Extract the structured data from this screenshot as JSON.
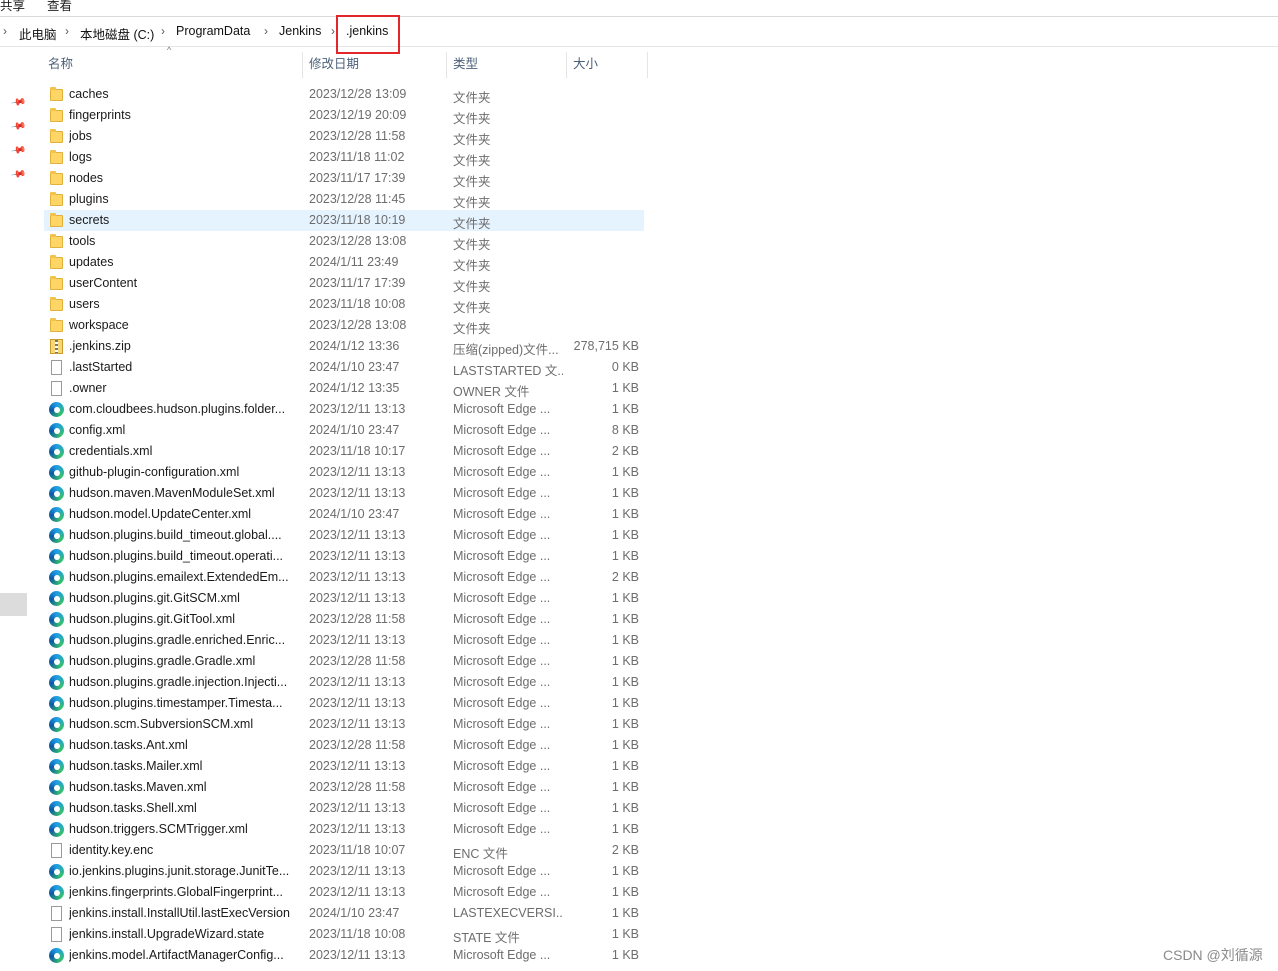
{
  "ribbon": {
    "tabs": [
      "共享",
      "查看"
    ]
  },
  "breadcrumb": [
    "此电脑",
    "本地磁盘 (C:)",
    "ProgramData",
    "Jenkins",
    ".jenkins"
  ],
  "columns": {
    "name": "名称",
    "date": "修改日期",
    "type": "类型",
    "size": "大小"
  },
  "files": [
    {
      "name": "caches",
      "date": "2023/12/28 13:09",
      "type": "文件夹",
      "size": "",
      "icon": "folder-icon"
    },
    {
      "name": "fingerprints",
      "date": "2023/12/19 20:09",
      "type": "文件夹",
      "size": "",
      "icon": "folder-icon"
    },
    {
      "name": "jobs",
      "date": "2023/12/28 11:58",
      "type": "文件夹",
      "size": "",
      "icon": "folder-icon"
    },
    {
      "name": "logs",
      "date": "2023/11/18 11:02",
      "type": "文件夹",
      "size": "",
      "icon": "folder-icon"
    },
    {
      "name": "nodes",
      "date": "2023/11/17 17:39",
      "type": "文件夹",
      "size": "",
      "icon": "folder-icon"
    },
    {
      "name": "plugins",
      "date": "2023/12/28 11:45",
      "type": "文件夹",
      "size": "",
      "icon": "folder-icon"
    },
    {
      "name": "secrets",
      "date": "2023/11/18 10:19",
      "type": "文件夹",
      "size": "",
      "icon": "folder-icon",
      "selected": true
    },
    {
      "name": "tools",
      "date": "2023/12/28 13:08",
      "type": "文件夹",
      "size": "",
      "icon": "folder-icon"
    },
    {
      "name": "updates",
      "date": "2024/1/11 23:49",
      "type": "文件夹",
      "size": "",
      "icon": "folder-icon"
    },
    {
      "name": "userContent",
      "date": "2023/11/17 17:39",
      "type": "文件夹",
      "size": "",
      "icon": "folder-icon"
    },
    {
      "name": "users",
      "date": "2023/11/18 10:08",
      "type": "文件夹",
      "size": "",
      "icon": "folder-icon"
    },
    {
      "name": "workspace",
      "date": "2023/12/28 13:08",
      "type": "文件夹",
      "size": "",
      "icon": "folder-icon"
    },
    {
      "name": ".jenkins.zip",
      "date": "2024/1/12 13:36",
      "type": "压缩(zipped)文件...",
      "size": "278,715 KB",
      "icon": "zip-icon"
    },
    {
      "name": ".lastStarted",
      "date": "2024/1/10 23:47",
      "type": "LASTSTARTED 文...",
      "size": "0 KB",
      "icon": "file-icon"
    },
    {
      "name": ".owner",
      "date": "2024/1/12 13:35",
      "type": "OWNER 文件",
      "size": "1 KB",
      "icon": "file-icon"
    },
    {
      "name": "com.cloudbees.hudson.plugins.folder...",
      "date": "2023/12/11 13:13",
      "type": "Microsoft Edge ...",
      "size": "1 KB",
      "icon": "edge-icon"
    },
    {
      "name": "config.xml",
      "date": "2024/1/10 23:47",
      "type": "Microsoft Edge ...",
      "size": "8 KB",
      "icon": "edge-icon"
    },
    {
      "name": "credentials.xml",
      "date": "2023/11/18 10:17",
      "type": "Microsoft Edge ...",
      "size": "2 KB",
      "icon": "edge-icon"
    },
    {
      "name": "github-plugin-configuration.xml",
      "date": "2023/12/11 13:13",
      "type": "Microsoft Edge ...",
      "size": "1 KB",
      "icon": "edge-icon"
    },
    {
      "name": "hudson.maven.MavenModuleSet.xml",
      "date": "2023/12/11 13:13",
      "type": "Microsoft Edge ...",
      "size": "1 KB",
      "icon": "edge-icon"
    },
    {
      "name": "hudson.model.UpdateCenter.xml",
      "date": "2024/1/10 23:47",
      "type": "Microsoft Edge ...",
      "size": "1 KB",
      "icon": "edge-icon"
    },
    {
      "name": "hudson.plugins.build_timeout.global....",
      "date": "2023/12/11 13:13",
      "type": "Microsoft Edge ...",
      "size": "1 KB",
      "icon": "edge-icon"
    },
    {
      "name": "hudson.plugins.build_timeout.operati...",
      "date": "2023/12/11 13:13",
      "type": "Microsoft Edge ...",
      "size": "1 KB",
      "icon": "edge-icon"
    },
    {
      "name": "hudson.plugins.emailext.ExtendedEm...",
      "date": "2023/12/11 13:13",
      "type": "Microsoft Edge ...",
      "size": "2 KB",
      "icon": "edge-icon"
    },
    {
      "name": "hudson.plugins.git.GitSCM.xml",
      "date": "2023/12/11 13:13",
      "type": "Microsoft Edge ...",
      "size": "1 KB",
      "icon": "edge-icon"
    },
    {
      "name": "hudson.plugins.git.GitTool.xml",
      "date": "2023/12/28 11:58",
      "type": "Microsoft Edge ...",
      "size": "1 KB",
      "icon": "edge-icon"
    },
    {
      "name": "hudson.plugins.gradle.enriched.Enric...",
      "date": "2023/12/11 13:13",
      "type": "Microsoft Edge ...",
      "size": "1 KB",
      "icon": "edge-icon"
    },
    {
      "name": "hudson.plugins.gradle.Gradle.xml",
      "date": "2023/12/28 11:58",
      "type": "Microsoft Edge ...",
      "size": "1 KB",
      "icon": "edge-icon"
    },
    {
      "name": "hudson.plugins.gradle.injection.Injecti...",
      "date": "2023/12/11 13:13",
      "type": "Microsoft Edge ...",
      "size": "1 KB",
      "icon": "edge-icon"
    },
    {
      "name": "hudson.plugins.timestamper.Timesta...",
      "date": "2023/12/11 13:13",
      "type": "Microsoft Edge ...",
      "size": "1 KB",
      "icon": "edge-icon"
    },
    {
      "name": "hudson.scm.SubversionSCM.xml",
      "date": "2023/12/11 13:13",
      "type": "Microsoft Edge ...",
      "size": "1 KB",
      "icon": "edge-icon"
    },
    {
      "name": "hudson.tasks.Ant.xml",
      "date": "2023/12/28 11:58",
      "type": "Microsoft Edge ...",
      "size": "1 KB",
      "icon": "edge-icon"
    },
    {
      "name": "hudson.tasks.Mailer.xml",
      "date": "2023/12/11 13:13",
      "type": "Microsoft Edge ...",
      "size": "1 KB",
      "icon": "edge-icon"
    },
    {
      "name": "hudson.tasks.Maven.xml",
      "date": "2023/12/28 11:58",
      "type": "Microsoft Edge ...",
      "size": "1 KB",
      "icon": "edge-icon"
    },
    {
      "name": "hudson.tasks.Shell.xml",
      "date": "2023/12/11 13:13",
      "type": "Microsoft Edge ...",
      "size": "1 KB",
      "icon": "edge-icon"
    },
    {
      "name": "hudson.triggers.SCMTrigger.xml",
      "date": "2023/12/11 13:13",
      "type": "Microsoft Edge ...",
      "size": "1 KB",
      "icon": "edge-icon"
    },
    {
      "name": "identity.key.enc",
      "date": "2023/11/18 10:07",
      "type": "ENC 文件",
      "size": "2 KB",
      "icon": "file-icon"
    },
    {
      "name": "io.jenkins.plugins.junit.storage.JunitTe...",
      "date": "2023/12/11 13:13",
      "type": "Microsoft Edge ...",
      "size": "1 KB",
      "icon": "edge-icon"
    },
    {
      "name": "jenkins.fingerprints.GlobalFingerprint...",
      "date": "2023/12/11 13:13",
      "type": "Microsoft Edge ...",
      "size": "1 KB",
      "icon": "edge-icon"
    },
    {
      "name": "jenkins.install.InstallUtil.lastExecVersion",
      "date": "2024/1/10 23:47",
      "type": "LASTEXECVERSI...",
      "size": "1 KB",
      "icon": "file-icon"
    },
    {
      "name": "jenkins.install.UpgradeWizard.state",
      "date": "2023/11/18 10:08",
      "type": "STATE 文件",
      "size": "1 KB",
      "icon": "file-icon"
    },
    {
      "name": "jenkins.model.ArtifactManagerConfig...",
      "date": "2023/12/11 13:13",
      "type": "Microsoft Edge ...",
      "size": "1 KB",
      "icon": "edge-icon"
    }
  ],
  "watermark": "CSDN @刘循源"
}
